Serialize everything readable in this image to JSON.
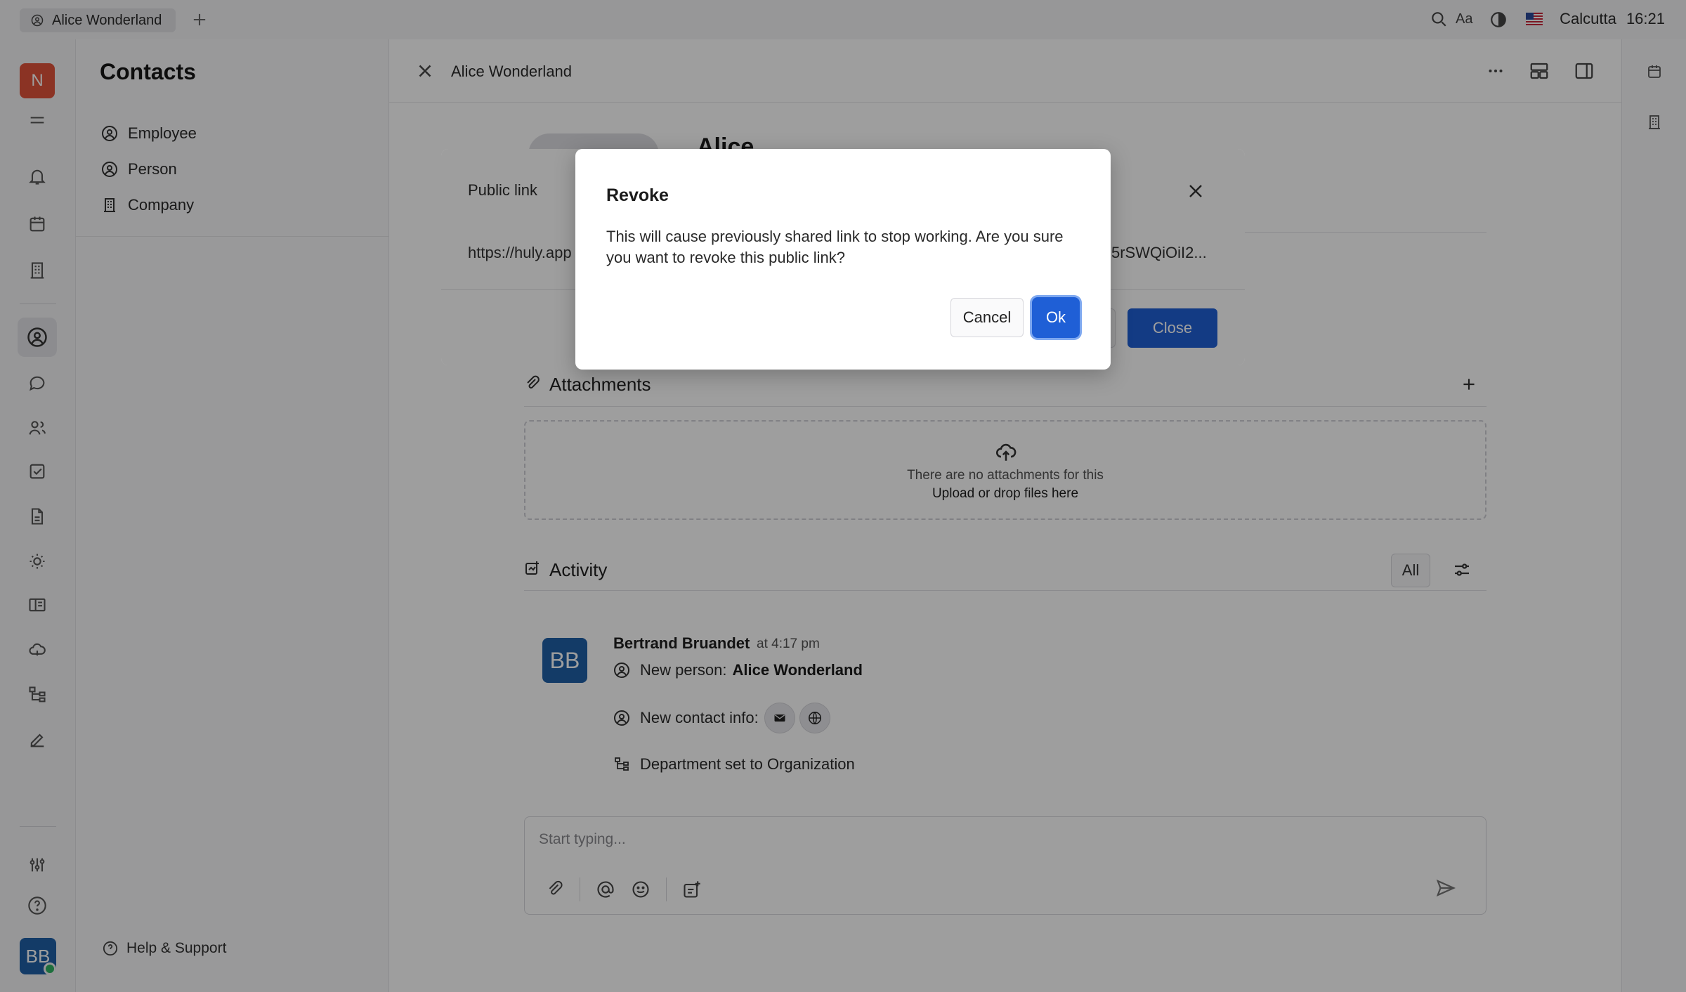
{
  "topbar": {
    "tab_label": "Alice Wonderland",
    "city": "Calcutta",
    "time": "16:21",
    "font_label": "Aa"
  },
  "rail": {
    "workspace_initial": "N",
    "user_initials": "BB"
  },
  "navigator": {
    "title": "Contacts",
    "items": [
      {
        "label": "Employee",
        "icon": "person-circle-icon"
      },
      {
        "label": "Person",
        "icon": "person-circle-icon"
      },
      {
        "label": "Company",
        "icon": "building-icon"
      }
    ],
    "help_label": "Help & Support"
  },
  "main": {
    "title": "Alice Wonderland",
    "person_name": "Alice",
    "attachments": {
      "title": "Attachments",
      "empty_text": "There are no attachments for this",
      "upload_text": "Upload or drop files here"
    },
    "activity": {
      "title": "Activity",
      "filter_label": "All",
      "author_initials": "BB",
      "author": "Bertrand Bruandet",
      "time": "at 4:17 pm",
      "new_person_label": "New person:",
      "new_person_name": "Alice Wonderland",
      "contact_info_label": "New contact info:",
      "department_text": "Department set to Organization"
    },
    "composer": {
      "placeholder": "Start typing..."
    }
  },
  "public_link_dialog": {
    "title": "Public link",
    "link_start": "https://huly.app",
    "link_end": "5rSWQiOiI2...",
    "close_label": "Close"
  },
  "revoke_dialog": {
    "title": "Revoke",
    "message": "This will cause previously shared link to stop working. Are you sure you want to revoke this public link?",
    "cancel_label": "Cancel",
    "ok_label": "Ok"
  },
  "colors": {
    "accent": "#1f5fd6",
    "workspace_badge": "#e0533a",
    "avatar": "#1f5fa6",
    "online": "#2fb463"
  }
}
